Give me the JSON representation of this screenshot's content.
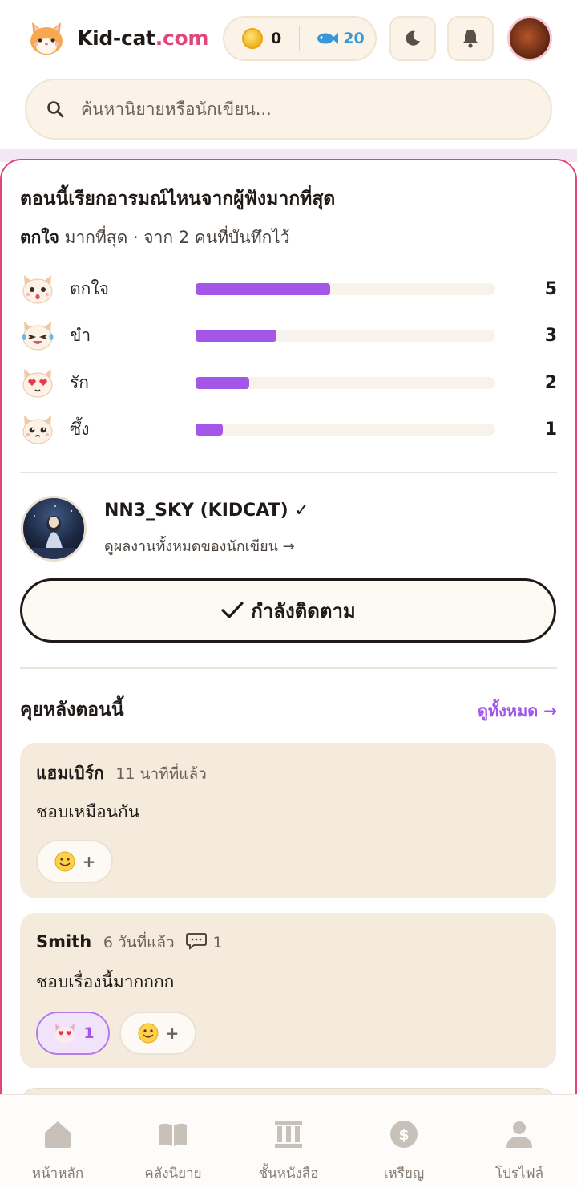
{
  "header": {
    "brand_main": "Kid-cat",
    "brand_domain": ".com",
    "coins": "0",
    "fish": "20",
    "search_placeholder": "ค้นหานิยายหรือนักเขียน..."
  },
  "emotion": {
    "title": "ตอนนี้เรียกอารมณ์ไหนจากผู้ฟังมากที่สุด",
    "top_emotion": "ตกใจ",
    "summary": " มากที่สุด · จาก 2 คนที่บันทึกไว้",
    "rows": [
      {
        "label": "ตกใจ",
        "count": "5",
        "share": 0.45
      },
      {
        "label": "ขำ",
        "count": "3",
        "share": 0.27
      },
      {
        "label": "รัก",
        "count": "2",
        "share": 0.18
      },
      {
        "label": "ซึ้ง",
        "count": "1",
        "share": 0.09
      }
    ]
  },
  "author": {
    "name": "NN3_SKY (KIDCAT)",
    "verified_mark": "✓",
    "link": "ดูผลงานทั้งหมดของนักเขียน →",
    "follow_label": "กำลังติดตาม"
  },
  "comments_section": {
    "title": "คุยหลังตอนนี้",
    "see_all": "ดูทั้งหมด →",
    "items": [
      {
        "name": "แฮมเบิร์ก",
        "time": "11 นาทีที่แล้ว",
        "text": "ชอบเหมือนกัน",
        "add_label": "+"
      },
      {
        "name": "Smith",
        "time": "6 วันที่แล้ว",
        "replies": "1",
        "text": "ชอบเรื่องนี้มากกกก",
        "love_count": "1",
        "add_label": "+"
      }
    ]
  },
  "nav": [
    {
      "label": "หน้าหลัก",
      "icon": "home-icon"
    },
    {
      "label": "คลังนิยาย",
      "icon": "book-icon"
    },
    {
      "label": "ชั้นหนังสือ",
      "icon": "shelf-icon"
    },
    {
      "label": "เหรียญ",
      "icon": "coin-icon"
    },
    {
      "label": "โปรไฟล์",
      "icon": "profile-icon"
    }
  ],
  "colors": {
    "brand_pink": "#e0457b",
    "accent_purple": "#a456e8",
    "fish_blue": "#3a96d6",
    "cream": "#fbf3e8"
  }
}
